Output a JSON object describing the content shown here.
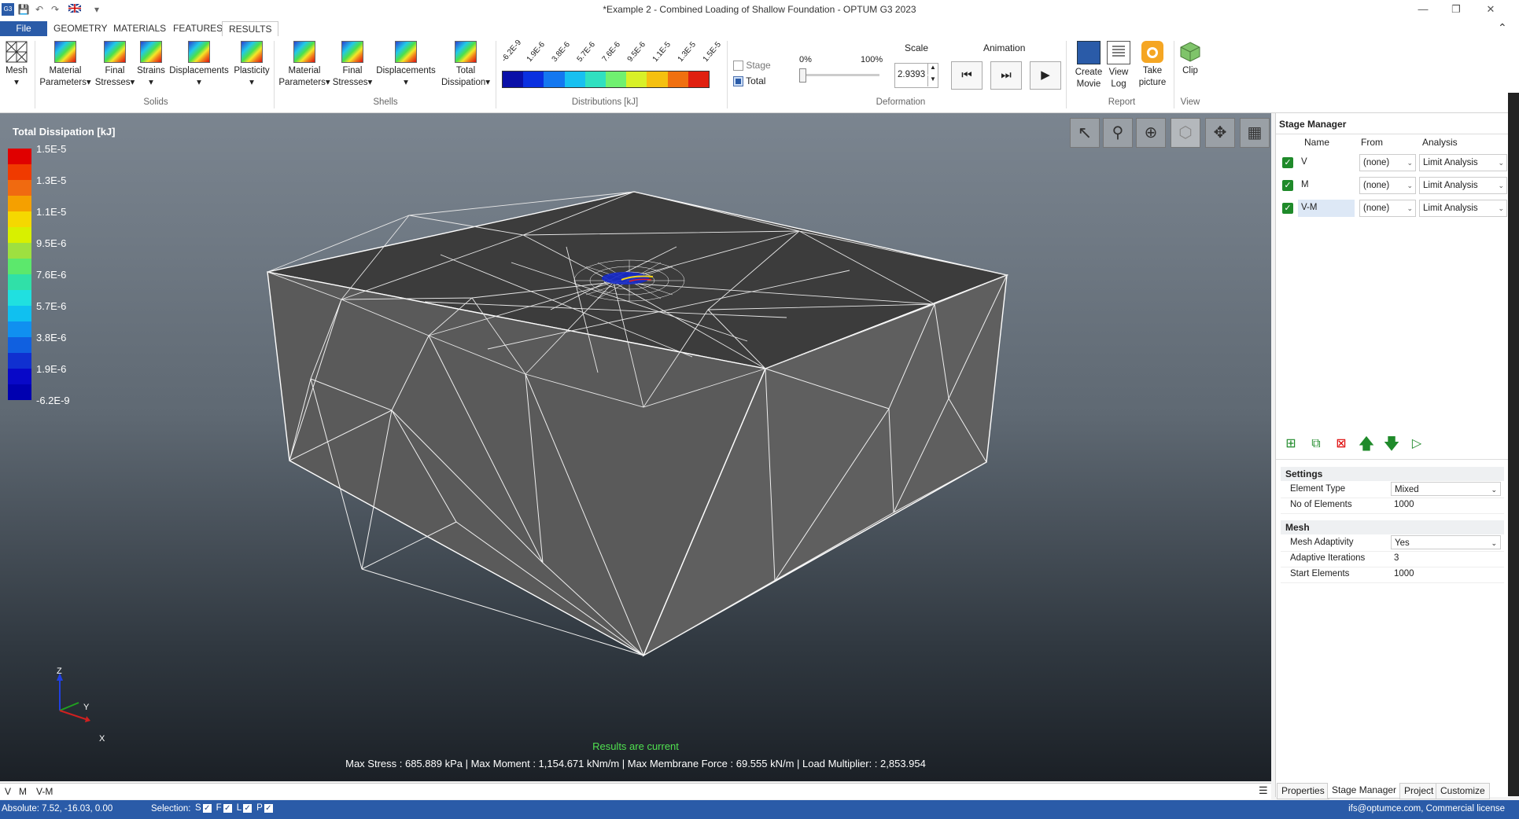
{
  "window": {
    "title": "*Example 2 - Combined Loading of Shallow Foundation - OPTUM G3 2023",
    "quick_access": [
      "G3",
      "save-icon",
      "undo-icon",
      "redo-icon",
      "uk-flag-icon",
      "▾"
    ]
  },
  "menu_tabs": [
    "File",
    "GEOMETRY",
    "MATERIALS",
    "FEATURES",
    "RESULTS"
  ],
  "ribbon": {
    "mesh": {
      "label": "Mesh",
      "arrow": "▾"
    },
    "solids": {
      "group_label": "Solids",
      "buttons": [
        {
          "label1": "Material",
          "label2": "Parameters▾"
        },
        {
          "label1": "Final",
          "label2": "Stresses▾"
        },
        {
          "label1": "Strains",
          "label2": "▾"
        },
        {
          "label1": "Displacements",
          "label2": "▾"
        },
        {
          "label1": "Plasticity",
          "label2": "▾"
        }
      ]
    },
    "shells": {
      "group_label": "Shells",
      "buttons": [
        {
          "label1": "Material",
          "label2": "Parameters▾"
        },
        {
          "label1": "Final",
          "label2": "Stresses▾"
        },
        {
          "label1": "Displacements",
          "label2": "▾"
        },
        {
          "label1": "Total",
          "label2": "Dissipation▾"
        }
      ]
    },
    "distributions": {
      "group_label": "Distributions [kJ]",
      "ticks": [
        "-6.2E-9",
        "1.9E-6",
        "3.8E-6",
        "5.7E-6",
        "7.6E-6",
        "9.5E-6",
        "1.1E-5",
        "1.3E-5",
        "1.5E-5"
      ]
    },
    "stage_total": {
      "stage_label": "Stage",
      "total_label": "Total",
      "stage_checked": false,
      "total_checked": true
    },
    "deformation": {
      "group_label": "Deformation",
      "slider_min": "0%",
      "slider_max": "100%",
      "slider_value": 0,
      "scale_label": "Scale",
      "scale_value": "2.9393"
    },
    "animation": {
      "label": "Animation"
    },
    "report": {
      "group_label": "Report",
      "buttons": [
        {
          "label1": "Create",
          "label2": "Movie"
        },
        {
          "label1": "View",
          "label2": "Log"
        },
        {
          "label1": "Take",
          "label2": "picture"
        }
      ]
    },
    "view": {
      "group_label": "View",
      "clip_label": "Clip"
    }
  },
  "legend": {
    "title": "Total Dissipation [kJ]",
    "labels": [
      "1.5E-5",
      "1.3E-5",
      "1.1E-5",
      "9.5E-6",
      "7.6E-6",
      "5.7E-6",
      "3.8E-6",
      "1.9E-6",
      "-6.2E-9"
    ],
    "colors": [
      "#e00000",
      "#f03a00",
      "#f06a10",
      "#f5a000",
      "#f5d800",
      "#d8f000",
      "#9ee040",
      "#5ce86c",
      "#30e0a8",
      "#20e0e0",
      "#10c0f0",
      "#1090f0",
      "#1060e0",
      "#1030d0",
      "#0808c8",
      "#0000b0"
    ]
  },
  "viewport": {
    "status_current": "Results are current",
    "status_max": "Max Stress : 685.889 kPa | Max Moment : 1,154.671 kNm/m | Max Membrane Force : 69.555 kN/m | Load Multiplier:  : 2,853.954",
    "axes": {
      "x": "X",
      "y": "Y",
      "z": "Z"
    }
  },
  "stage_manager": {
    "title": "Stage Manager",
    "columns": [
      "Name",
      "From",
      "Analysis"
    ],
    "rows": [
      {
        "name": "V",
        "from": "(none)",
        "analysis": "Limit Analysis",
        "checked": true
      },
      {
        "name": "M",
        "from": "(none)",
        "analysis": "Limit Analysis",
        "checked": true
      },
      {
        "name": "V-M",
        "from": "(none)",
        "analysis": "Limit Analysis",
        "checked": true
      }
    ]
  },
  "settings": {
    "title": "Settings",
    "props": [
      {
        "key": "Element Type",
        "value": "Mixed"
      },
      {
        "key": "No of Elements",
        "value": "1000"
      }
    ]
  },
  "mesh": {
    "title": "Mesh",
    "props": [
      {
        "key": "Mesh Adaptivity",
        "value": "Yes"
      },
      {
        "key": "Adaptive Iterations",
        "value": "3"
      },
      {
        "key": "Start Elements",
        "value": "1000"
      }
    ]
  },
  "panel_tabs": [
    "Properties",
    "Stage Manager",
    "Project",
    "Customize"
  ],
  "stage_strip": {
    "items": [
      "V",
      "M",
      "V-M"
    ]
  },
  "statusbar": {
    "absolute": "Absolute:  7.52, -16.03, 0.00",
    "selection_label": "Selection:",
    "selection_flags": [
      "S",
      "F",
      "L",
      "P"
    ],
    "license": "ifs@optumce.com, Commercial license"
  }
}
